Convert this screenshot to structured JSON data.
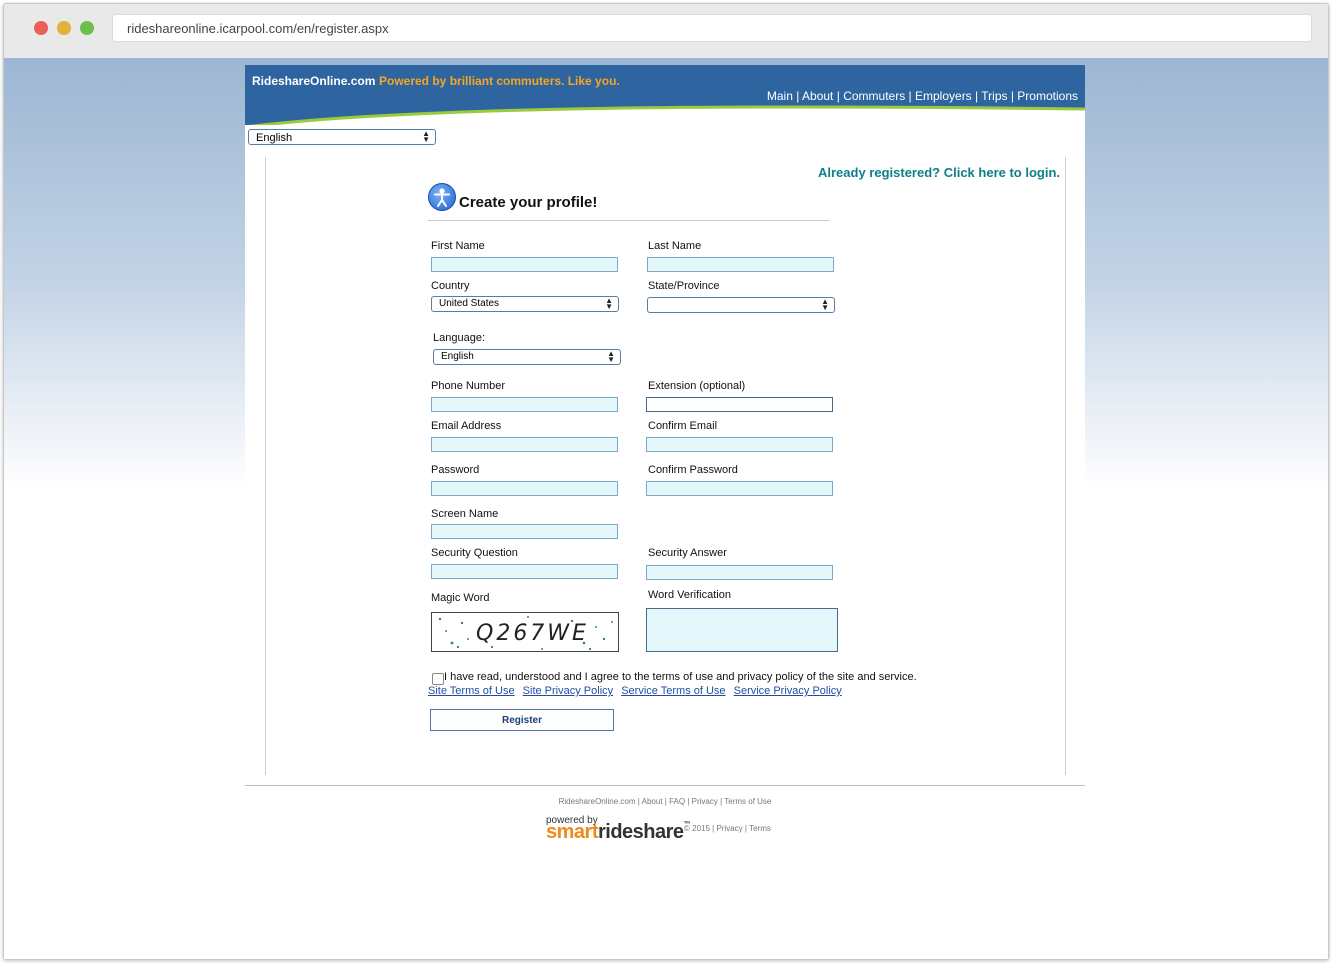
{
  "browser": {
    "url": "rideshareonline.icarpool.com/en/register.aspx"
  },
  "header": {
    "brand": "RideshareOnline.com",
    "tagline": "Powered by brilliant commuters. Like you.",
    "nav": [
      "Main",
      "About",
      "Commuters",
      "Employers",
      "Trips",
      "Promotions"
    ]
  },
  "language_top": {
    "selected": "English"
  },
  "login_link": "Already registered? Click here to login.",
  "form": {
    "title": "Create your profile!",
    "first_name_label": "First Name",
    "last_name_label": "Last Name",
    "country_label": "Country",
    "country_value": "United States",
    "state_label": "State/Province",
    "state_value": "",
    "language_label": "Language:",
    "language_value": "English",
    "phone_label": "Phone Number",
    "extension_label": "Extension (optional)",
    "email_label": "Email Address",
    "confirm_email_label": "Confirm Email",
    "password_label": "Password",
    "confirm_password_label": "Confirm Password",
    "screen_name_label": "Screen Name",
    "security_question_label": "Security Question",
    "security_answer_label": "Security Answer",
    "magic_word_label": "Magic Word",
    "captcha_text": "Q267WE",
    "word_verification_label": "Word Verification",
    "agree_text": "I have read, understood and I agree to the terms of use and privacy policy of the site and service.",
    "policy_links": [
      "Site Terms of Use",
      "Site Privacy Policy",
      "Service Terms of Use",
      "Service Privacy Policy"
    ],
    "register_label": "Register"
  },
  "footer": {
    "links": [
      "RideshareOnline.com",
      "About",
      "FAQ",
      "Privacy",
      "Terms of Use"
    ],
    "powered_by": "powered by",
    "logo_smart": "smart",
    "logo_rideshare": "rideshare",
    "logo_tm": "™",
    "copyright": "© 2015",
    "copyright_links": [
      "Privacy",
      "Terms"
    ]
  },
  "colors": {
    "header_blue": "#2e65a0",
    "tagline_orange": "#f5a623",
    "login_teal": "#0e7f8a",
    "link_blue": "#1d4f9e",
    "field_fill": "#e4f8fc"
  }
}
